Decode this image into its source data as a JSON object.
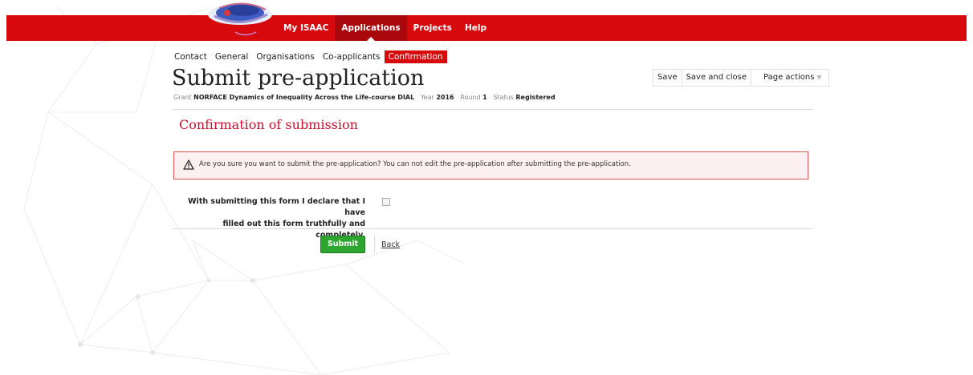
{
  "nav": {
    "items": [
      {
        "label": "My ISAAC",
        "active": false
      },
      {
        "label": "Applications",
        "active": true
      },
      {
        "label": "Projects",
        "active": false
      },
      {
        "label": "Help",
        "active": false
      }
    ]
  },
  "subtabs": [
    {
      "label": "Contact",
      "active": false
    },
    {
      "label": "General",
      "active": false
    },
    {
      "label": "Organisations",
      "active": false
    },
    {
      "label": "Co-applicants",
      "active": false
    },
    {
      "label": "Confirmation",
      "active": true
    }
  ],
  "page": {
    "title": "Submit pre-application",
    "meta": {
      "grant_label": "Grant",
      "grant_value": "NORFACE Dynamics of Inequality Across the Life-course DIAL",
      "year_label": "Year",
      "year_value": "2016",
      "round_label": "Round",
      "round_value": "1",
      "status_label": "Status",
      "status_value": "Registered"
    }
  },
  "actions": {
    "save": "Save",
    "save_close": "Save and close",
    "page_actions": "Page actions"
  },
  "section": {
    "title": "Confirmation of submission"
  },
  "alert": {
    "icon": "warning-icon",
    "text": "Are you sure you want to submit the pre-application? You can not edit the pre-application after submitting the pre-application."
  },
  "declaration": {
    "line1": "With submitting this form I declare that I have",
    "line2": "filled out this form truthfully and completely.",
    "checked": false
  },
  "buttons": {
    "submit": "Submit",
    "back": "Back"
  },
  "colors": {
    "brand_red": "#d7090d",
    "active_nav": "#a8070b",
    "section_title": "#c8102e",
    "submit_green": "#2ea52e"
  }
}
